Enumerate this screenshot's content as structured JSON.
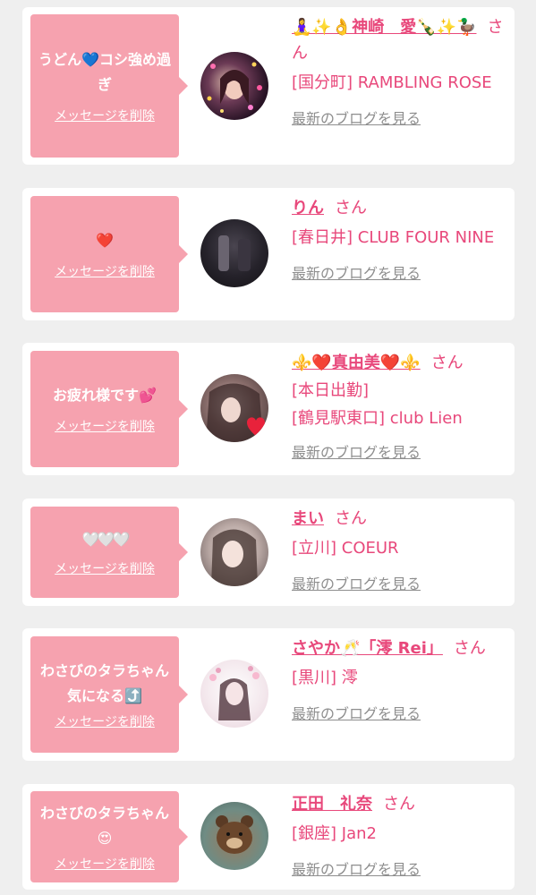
{
  "delete_label": "メッセージを削除",
  "blog_label": "最新のブログを見る",
  "san_label": "さん",
  "messages": [
    {
      "text": "うどん💙コシ強め過ぎ",
      "name": "🧘‍♀️✨👌神崎　愛🍾✨🦆",
      "shop_lines": [
        "[国分町] RAMBLING ROSE"
      ]
    },
    {
      "text": "❤️",
      "name": "りん",
      "shop_lines": [
        "[春日井] CLUB FOUR NINE"
      ]
    },
    {
      "text": "お疲れ様です💕",
      "name": "⚜️❤️真由美❤️⚜️",
      "shop_lines": [
        "[本日出勤]",
        "[鶴見駅東口] club Lien"
      ]
    },
    {
      "text": "🤍🤍🤍",
      "name": "まい",
      "shop_lines": [
        "[立川] COEUR"
      ]
    },
    {
      "text": "わさびのタラちゃん気になる⤴️",
      "name": "さやか🥂「澪 Rei」",
      "shop_lines": [
        "[黒川] 澪"
      ]
    },
    {
      "text": "わさびのタラちゃん😍",
      "name": "正田　礼奈",
      "shop_lines": [
        "[銀座] Jan2"
      ]
    }
  ]
}
